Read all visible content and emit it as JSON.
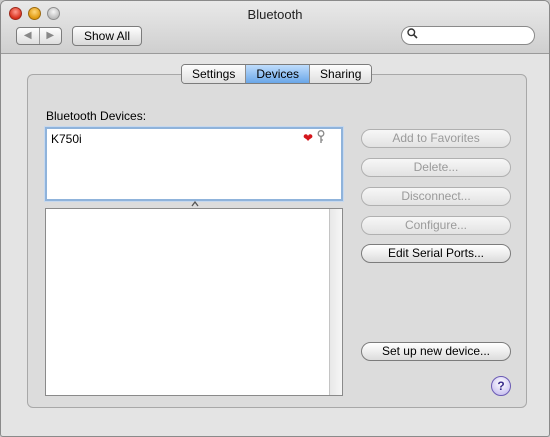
{
  "window": {
    "title": "Bluetooth"
  },
  "toolbar": {
    "back_glyph": "◀",
    "forward_glyph": "▶",
    "show_all_label": "Show All",
    "search_value": "",
    "search_placeholder": ""
  },
  "tabs": [
    {
      "label": "Settings",
      "active": false
    },
    {
      "label": "Devices",
      "active": true
    },
    {
      "label": "Sharing",
      "active": false
    }
  ],
  "devices": {
    "label": "Bluetooth Devices:",
    "items": [
      {
        "name": "K750i",
        "status_icons": [
          "heart-icon",
          "key-icon"
        ]
      }
    ]
  },
  "buttons": {
    "add_favorites": "Add to Favorites",
    "delete": "Delete...",
    "disconnect": "Disconnect...",
    "configure": "Configure...",
    "edit_serial": "Edit Serial Ports...",
    "setup_new": "Set up new device..."
  },
  "help": {
    "label": "?"
  },
  "colors": {
    "active_tab": "#6aa6e8",
    "selection_border": "#8fb3db",
    "heart": "#d4161c"
  }
}
